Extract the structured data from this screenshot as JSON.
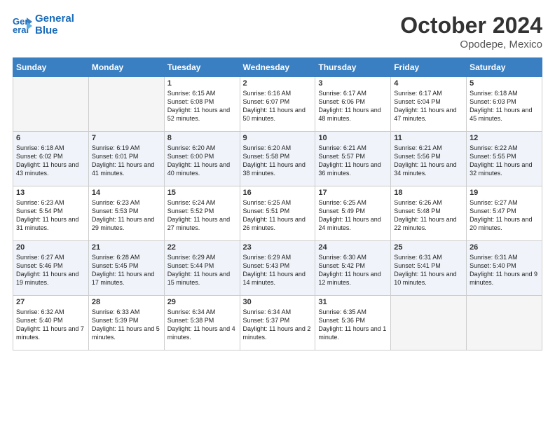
{
  "header": {
    "logo_line1": "General",
    "logo_line2": "Blue",
    "month": "October 2024",
    "location": "Opodepe, Mexico"
  },
  "weekdays": [
    "Sunday",
    "Monday",
    "Tuesday",
    "Wednesday",
    "Thursday",
    "Friday",
    "Saturday"
  ],
  "weeks": [
    [
      {
        "day": "",
        "sunrise": "",
        "sunset": "",
        "daylight": ""
      },
      {
        "day": "",
        "sunrise": "",
        "sunset": "",
        "daylight": ""
      },
      {
        "day": "1",
        "sunrise": "Sunrise: 6:15 AM",
        "sunset": "Sunset: 6:08 PM",
        "daylight": "Daylight: 11 hours and 52 minutes."
      },
      {
        "day": "2",
        "sunrise": "Sunrise: 6:16 AM",
        "sunset": "Sunset: 6:07 PM",
        "daylight": "Daylight: 11 hours and 50 minutes."
      },
      {
        "day": "3",
        "sunrise": "Sunrise: 6:17 AM",
        "sunset": "Sunset: 6:06 PM",
        "daylight": "Daylight: 11 hours and 48 minutes."
      },
      {
        "day": "4",
        "sunrise": "Sunrise: 6:17 AM",
        "sunset": "Sunset: 6:04 PM",
        "daylight": "Daylight: 11 hours and 47 minutes."
      },
      {
        "day": "5",
        "sunrise": "Sunrise: 6:18 AM",
        "sunset": "Sunset: 6:03 PM",
        "daylight": "Daylight: 11 hours and 45 minutes."
      }
    ],
    [
      {
        "day": "6",
        "sunrise": "Sunrise: 6:18 AM",
        "sunset": "Sunset: 6:02 PM",
        "daylight": "Daylight: 11 hours and 43 minutes."
      },
      {
        "day": "7",
        "sunrise": "Sunrise: 6:19 AM",
        "sunset": "Sunset: 6:01 PM",
        "daylight": "Daylight: 11 hours and 41 minutes."
      },
      {
        "day": "8",
        "sunrise": "Sunrise: 6:20 AM",
        "sunset": "Sunset: 6:00 PM",
        "daylight": "Daylight: 11 hours and 40 minutes."
      },
      {
        "day": "9",
        "sunrise": "Sunrise: 6:20 AM",
        "sunset": "Sunset: 5:58 PM",
        "daylight": "Daylight: 11 hours and 38 minutes."
      },
      {
        "day": "10",
        "sunrise": "Sunrise: 6:21 AM",
        "sunset": "Sunset: 5:57 PM",
        "daylight": "Daylight: 11 hours and 36 minutes."
      },
      {
        "day": "11",
        "sunrise": "Sunrise: 6:21 AM",
        "sunset": "Sunset: 5:56 PM",
        "daylight": "Daylight: 11 hours and 34 minutes."
      },
      {
        "day": "12",
        "sunrise": "Sunrise: 6:22 AM",
        "sunset": "Sunset: 5:55 PM",
        "daylight": "Daylight: 11 hours and 32 minutes."
      }
    ],
    [
      {
        "day": "13",
        "sunrise": "Sunrise: 6:23 AM",
        "sunset": "Sunset: 5:54 PM",
        "daylight": "Daylight: 11 hours and 31 minutes."
      },
      {
        "day": "14",
        "sunrise": "Sunrise: 6:23 AM",
        "sunset": "Sunset: 5:53 PM",
        "daylight": "Daylight: 11 hours and 29 minutes."
      },
      {
        "day": "15",
        "sunrise": "Sunrise: 6:24 AM",
        "sunset": "Sunset: 5:52 PM",
        "daylight": "Daylight: 11 hours and 27 minutes."
      },
      {
        "day": "16",
        "sunrise": "Sunrise: 6:25 AM",
        "sunset": "Sunset: 5:51 PM",
        "daylight": "Daylight: 11 hours and 26 minutes."
      },
      {
        "day": "17",
        "sunrise": "Sunrise: 6:25 AM",
        "sunset": "Sunset: 5:49 PM",
        "daylight": "Daylight: 11 hours and 24 minutes."
      },
      {
        "day": "18",
        "sunrise": "Sunrise: 6:26 AM",
        "sunset": "Sunset: 5:48 PM",
        "daylight": "Daylight: 11 hours and 22 minutes."
      },
      {
        "day": "19",
        "sunrise": "Sunrise: 6:27 AM",
        "sunset": "Sunset: 5:47 PM",
        "daylight": "Daylight: 11 hours and 20 minutes."
      }
    ],
    [
      {
        "day": "20",
        "sunrise": "Sunrise: 6:27 AM",
        "sunset": "Sunset: 5:46 PM",
        "daylight": "Daylight: 11 hours and 19 minutes."
      },
      {
        "day": "21",
        "sunrise": "Sunrise: 6:28 AM",
        "sunset": "Sunset: 5:45 PM",
        "daylight": "Daylight: 11 hours and 17 minutes."
      },
      {
        "day": "22",
        "sunrise": "Sunrise: 6:29 AM",
        "sunset": "Sunset: 5:44 PM",
        "daylight": "Daylight: 11 hours and 15 minutes."
      },
      {
        "day": "23",
        "sunrise": "Sunrise: 6:29 AM",
        "sunset": "Sunset: 5:43 PM",
        "daylight": "Daylight: 11 hours and 14 minutes."
      },
      {
        "day": "24",
        "sunrise": "Sunrise: 6:30 AM",
        "sunset": "Sunset: 5:42 PM",
        "daylight": "Daylight: 11 hours and 12 minutes."
      },
      {
        "day": "25",
        "sunrise": "Sunrise: 6:31 AM",
        "sunset": "Sunset: 5:41 PM",
        "daylight": "Daylight: 11 hours and 10 minutes."
      },
      {
        "day": "26",
        "sunrise": "Sunrise: 6:31 AM",
        "sunset": "Sunset: 5:40 PM",
        "daylight": "Daylight: 11 hours and 9 minutes."
      }
    ],
    [
      {
        "day": "27",
        "sunrise": "Sunrise: 6:32 AM",
        "sunset": "Sunset: 5:40 PM",
        "daylight": "Daylight: 11 hours and 7 minutes."
      },
      {
        "day": "28",
        "sunrise": "Sunrise: 6:33 AM",
        "sunset": "Sunset: 5:39 PM",
        "daylight": "Daylight: 11 hours and 5 minutes."
      },
      {
        "day": "29",
        "sunrise": "Sunrise: 6:34 AM",
        "sunset": "Sunset: 5:38 PM",
        "daylight": "Daylight: 11 hours and 4 minutes."
      },
      {
        "day": "30",
        "sunrise": "Sunrise: 6:34 AM",
        "sunset": "Sunset: 5:37 PM",
        "daylight": "Daylight: 11 hours and 2 minutes."
      },
      {
        "day": "31",
        "sunrise": "Sunrise: 6:35 AM",
        "sunset": "Sunset: 5:36 PM",
        "daylight": "Daylight: 11 hours and 1 minute."
      },
      {
        "day": "",
        "sunrise": "",
        "sunset": "",
        "daylight": ""
      },
      {
        "day": "",
        "sunrise": "",
        "sunset": "",
        "daylight": ""
      }
    ]
  ]
}
